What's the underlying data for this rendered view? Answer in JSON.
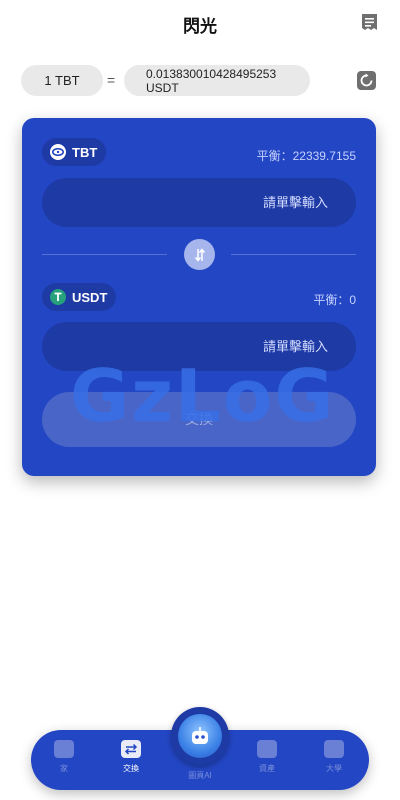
{
  "header": {
    "title": "閃光"
  },
  "rate": {
    "from": "1 TBT",
    "equals": "=",
    "to_value": "0.013830010428495253",
    "to_unit": "USDT"
  },
  "swap": {
    "from": {
      "token": "TBT",
      "balance": "平衡：22339.7155",
      "placeholder": "請單擊輸入"
    },
    "to": {
      "token": "USDT",
      "balance": "平衡：0",
      "placeholder": "請單擊輸入"
    },
    "watermark": "GzLoG",
    "exchange_label": "交換"
  },
  "nav": {
    "items": [
      {
        "label": "家",
        "icon": "home-icon"
      },
      {
        "label": "交換",
        "icon": "swap-icon",
        "active": true
      },
      {
        "label": "圖頁AI",
        "icon": "robot-icon"
      },
      {
        "label": "資產",
        "icon": "wallet-icon"
      },
      {
        "label": "大學",
        "icon": "chat-icon"
      }
    ]
  },
  "colors": {
    "card": "#2346c4",
    "card_inner": "#1d3aa5",
    "tether": "#26a17b"
  }
}
